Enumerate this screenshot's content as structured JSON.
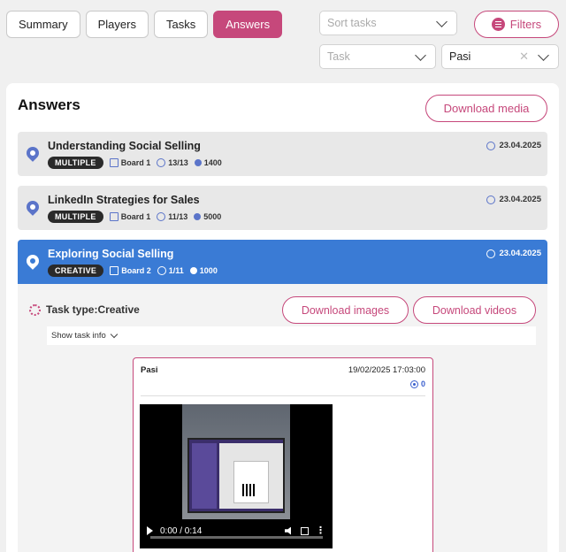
{
  "tabs": [
    {
      "label": "Summary",
      "active": false
    },
    {
      "label": "Players",
      "active": false
    },
    {
      "label": "Tasks",
      "active": false
    },
    {
      "label": "Answers",
      "active": true
    }
  ],
  "filters": {
    "sort_placeholder": "Sort tasks",
    "task_placeholder": "Task",
    "player_value": "Pasi",
    "filters_label": "Filters"
  },
  "answers": {
    "title": "Answers",
    "download_media_label": "Download media",
    "tasks": [
      {
        "title": "Understanding Social Selling",
        "type": "MULTIPLE",
        "board": "Board 1",
        "players": "13/13",
        "points": "1400",
        "date": "23.04.2025"
      },
      {
        "title": "LinkedIn Strategies for Sales",
        "type": "MULTIPLE",
        "board": "Board 1",
        "players": "11/13",
        "points": "5000",
        "date": "23.04.2025"
      },
      {
        "title": "Exploring Social Selling",
        "type": "CREATIVE",
        "board": "Board 2",
        "players": "1/11",
        "points": "1000",
        "date": "23.04.2025",
        "selected": true
      }
    ],
    "detail": {
      "task_type": "Task type:Creative",
      "download_images_label": "Download images",
      "download_videos_label": "Download videos",
      "show_task_info": "Show task info",
      "answer": {
        "player": "Pasi",
        "timestamp": "19/02/2025 17:03:00",
        "points": "0",
        "video_time": "0:00 / 0:14",
        "video_progress_pct": 0
      }
    }
  },
  "colors": {
    "accent": "#c6487b",
    "selected": "#3a7bd5",
    "icon": "#5b74c9"
  }
}
